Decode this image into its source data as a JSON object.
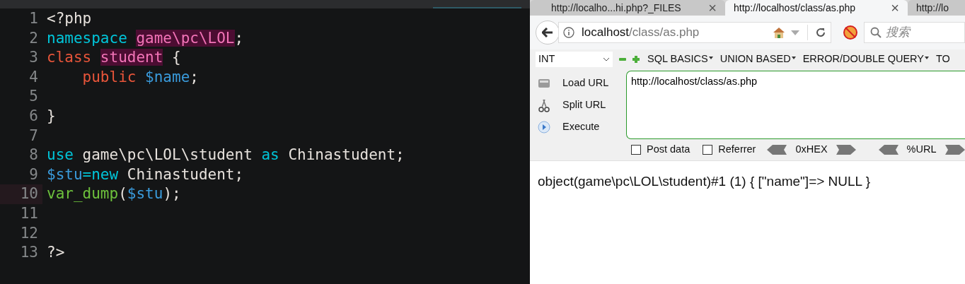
{
  "editor": {
    "lines": [
      {
        "number": "1",
        "current": false,
        "tokens": [
          {
            "kind": "plain",
            "text": "<?php"
          }
        ]
      },
      {
        "number": "2",
        "current": false,
        "tokens": [
          {
            "kind": "keyword",
            "text": "namespace "
          },
          {
            "kind": "entity",
            "text": "game\\pc\\LOL"
          },
          {
            "kind": "plain",
            "text": ";"
          }
        ]
      },
      {
        "number": "3",
        "current": false,
        "tokens": [
          {
            "kind": "storage",
            "text": "class "
          },
          {
            "kind": "entity",
            "text": "student"
          },
          {
            "kind": "plain",
            "text": " {"
          }
        ]
      },
      {
        "number": "4",
        "current": false,
        "tokens": [
          {
            "kind": "storage",
            "text": "    public "
          },
          {
            "kind": "variable",
            "text": "$name"
          },
          {
            "kind": "plain",
            "text": ";"
          }
        ]
      },
      {
        "number": "5",
        "current": false
      },
      {
        "number": "6",
        "current": false,
        "tokens": [
          {
            "kind": "plain",
            "text": "}"
          }
        ]
      },
      {
        "number": "7",
        "current": false
      },
      {
        "number": "8",
        "current": false,
        "tokens": [
          {
            "kind": "keyword",
            "text": "use"
          },
          {
            "kind": "plain",
            "text": " game\\pc\\LOL\\student "
          },
          {
            "kind": "keyword",
            "text": "as"
          },
          {
            "kind": "plain",
            "text": " Chinastudent;"
          }
        ]
      },
      {
        "number": "9",
        "current": false,
        "tokens": [
          {
            "kind": "variable",
            "text": "$stu"
          },
          {
            "kind": "keyword",
            "text": "=new"
          },
          {
            "kind": "plain",
            "text": " Chinastudent;"
          }
        ]
      },
      {
        "number": "10",
        "current": true,
        "tokens": [
          {
            "kind": "function",
            "text": "var_dump"
          },
          {
            "kind": "plain",
            "text": "("
          },
          {
            "kind": "variable",
            "text": "$stu"
          },
          {
            "kind": "plain",
            "text": ");"
          }
        ]
      },
      {
        "number": "11",
        "current": false
      },
      {
        "number": "12",
        "current": false
      },
      {
        "number": "13",
        "current": false,
        "tokens": [
          {
            "kind": "plain",
            "text": "?>"
          }
        ]
      }
    ]
  },
  "browser": {
    "tabs": [
      {
        "label": "http://localho...hi.php?_FILES",
        "selected": false,
        "close": "×"
      },
      {
        "label": "http://localhost/class/as.php",
        "selected": true,
        "close": "×"
      },
      {
        "label": "http://lo",
        "selected": false
      }
    ],
    "address": {
      "host": "localhost",
      "path": "/class/as.php"
    },
    "search": {
      "placeholder": "搜索"
    },
    "hackbar": {
      "select": "INT",
      "menus": [
        "SQL BASICS",
        "UNION BASED",
        "ERROR/DOUBLE QUERY",
        "TO"
      ],
      "actions": [
        {
          "label": "Load URL",
          "kind": "load"
        },
        {
          "label": "Split URL",
          "kind": "split"
        },
        {
          "label": "Execute",
          "kind": "execute"
        }
      ],
      "url": "http://localhost/class/as.php",
      "options": [
        {
          "label": "Post data",
          "checked": false
        },
        {
          "label": "Referrer",
          "checked": false
        }
      ],
      "encoders": [
        "0xHEX",
        "%URL"
      ]
    },
    "output": "object(game\\pc\\LOL\\student)#1 (1) { [\"name\"]=> NULL }"
  }
}
